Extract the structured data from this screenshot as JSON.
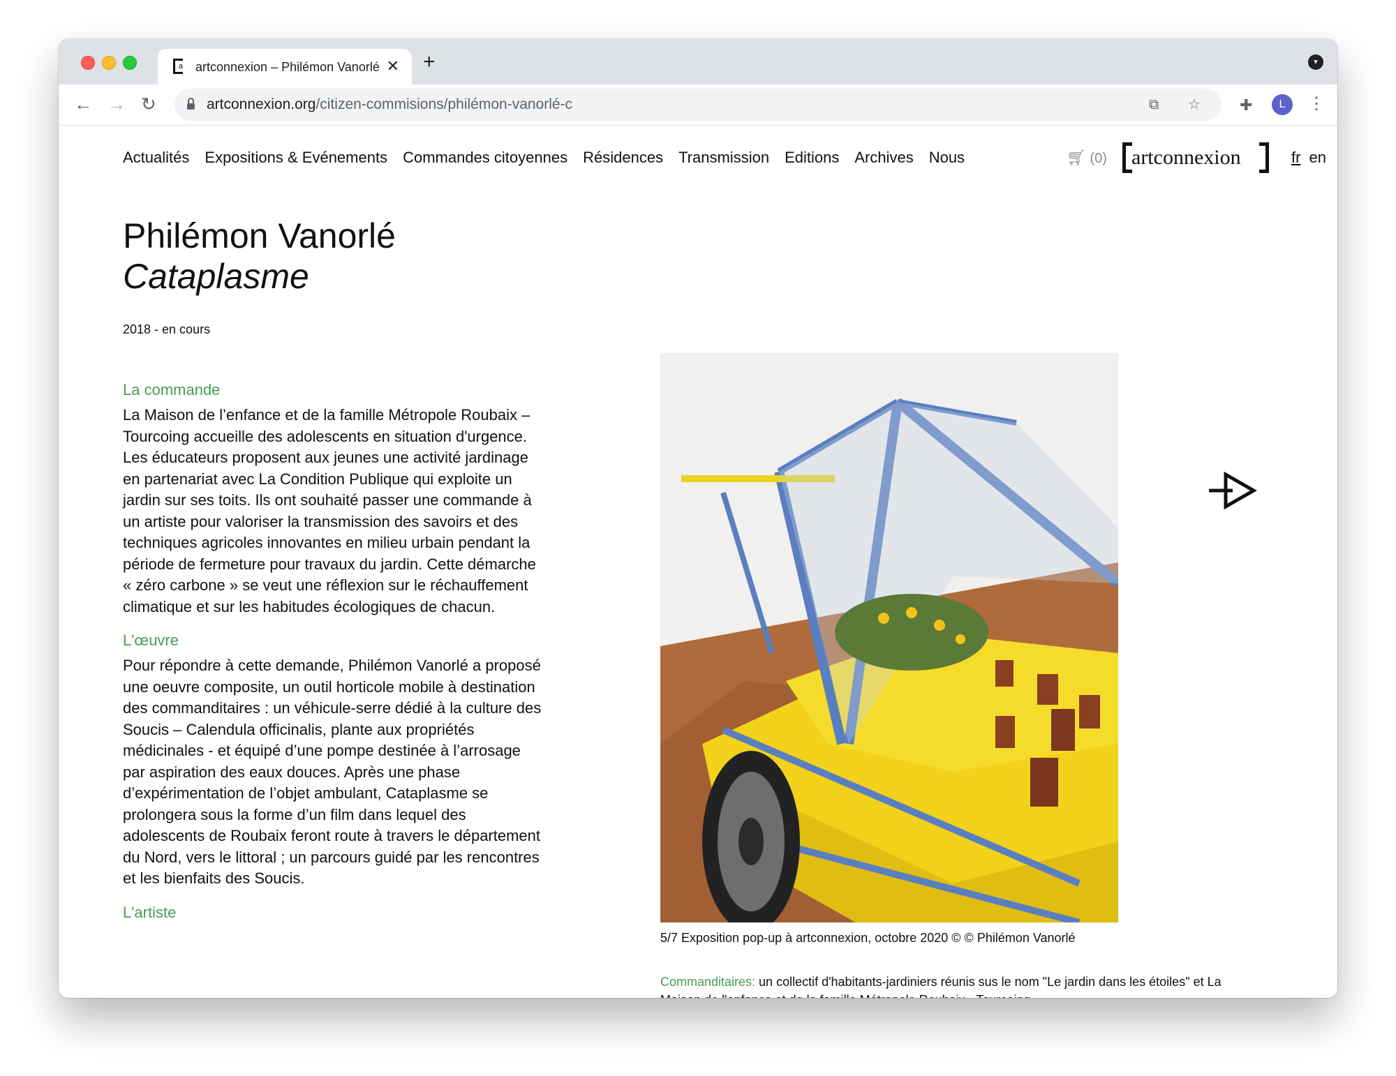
{
  "browser": {
    "tab_title": "artconnexion – Philémon Vanorlé",
    "tab_favicon_letter": "a",
    "close_glyph": "✕",
    "newtab_glyph": "+",
    "url_domain": "artconnexion.org",
    "url_path": "/citizen-commisions/philémon-vanorlé-c",
    "avatar_letter": "L",
    "icons": [
      "back-icon",
      "forward-icon",
      "reload-icon",
      "lock-icon",
      "translate-icon",
      "star-icon",
      "extensions-icon",
      "menu-icon"
    ]
  },
  "nav": {
    "items": [
      "Actualités",
      "Expositions & Evénements",
      "Commandes citoyennes",
      "Résidences",
      "Transmission",
      "Editions",
      "Archives",
      "Nous"
    ],
    "cart_count": "(0)",
    "logo_text": "artconnexion",
    "lang_fr": "fr",
    "lang_en": "en"
  },
  "project": {
    "artist": "Philémon Vanorlé",
    "title": "Cataplasme",
    "date": "2018 - en cours"
  },
  "sections": [
    {
      "heading": "La commande",
      "body": "La Maison de l’enfance et de la famille Métropole Roubaix – Tourcoing accueille des adolescents en situation d'urgence. Les éducateurs proposent aux jeunes une activité jardinage en partenariat avec La Condition Publique qui exploite un jardin sur ses toits. Ils ont souhaité passer une commande à un artiste pour valoriser la transmission des savoirs et des techniques agricoles innovantes en milieu urbain pendant la période de fermeture pour travaux du jardin. Cette démarche « zéro carbone » se veut une réflexion sur le réchauffement climatique et sur les habitudes écologiques de chacun."
    },
    {
      "heading": "L'œuvre",
      "body": "Pour répondre à cette demande, Philémon Vanorlé a proposé une oeuvre composite, un outil horticole mobile à destination des commanditaires : un véhicule-serre dédié à la culture des Soucis – Calendula officinalis, plante aux propriétés médicinales - et équipé d’une pompe destinée à l’arrosage par aspiration des eaux douces. Après une phase d’expérimentation de l’objet ambulant, Cataplasme se prolongera sous la forme d’un film dans lequel des adolescents de Roubaix feront route à travers le département du Nord, vers le littoral ; un parcours guidé par les rencontres et les bienfaits des Soucis."
    },
    {
      "heading": "L'artiste",
      "body": ""
    }
  ],
  "gallery": {
    "caption": "5/7 Exposition pop-up à artconnexion, octobre 2020 © © Philémon Vanorlé",
    "commanditaires_label": "Commanditaires:",
    "commanditaires_text": " un collectif d'habitants-jardiniers réunis sus le nom \"Le jardin dans les étoiles\" et La Maison de l'enfance et de la famille Métropole Roubaix - Tourcoing"
  }
}
